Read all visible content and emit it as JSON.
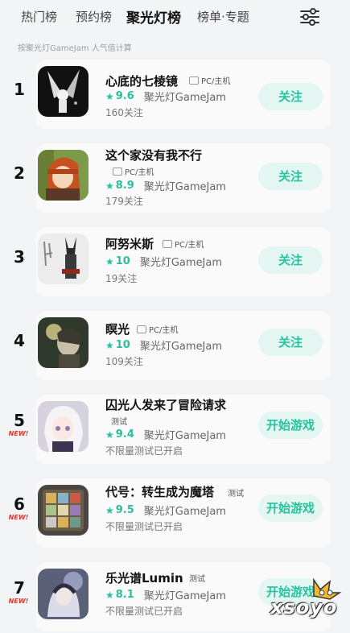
{
  "tabs": [
    {
      "label": "热门榜",
      "active": false
    },
    {
      "label": "预约榜",
      "active": false
    },
    {
      "label": "聚光灯榜",
      "active": true
    },
    {
      "label": "榜单·专题",
      "active": false
    }
  ],
  "filter_icon": "sliders-icon",
  "subtitle": "按聚光灯GameJam 人气值计算",
  "accent_color": "#2bbf9e",
  "new_color": "#e2332b",
  "games": [
    {
      "rank": "1",
      "is_new": false,
      "name": "心底的七棱镜",
      "tag": "PC/主机",
      "tag_type": "platform",
      "score": "9.6",
      "source": "聚光灯GameJam",
      "sub": "160关注",
      "button": "关注"
    },
    {
      "rank": "2",
      "is_new": false,
      "name": "这个家没有我不行",
      "tag": "PC/主机",
      "tag_type": "platform",
      "score": "8.9",
      "source": "聚光灯GameJam",
      "sub": "179关注",
      "button": "关注"
    },
    {
      "rank": "3",
      "is_new": false,
      "name": "阿努米斯",
      "tag": "PC/主机",
      "tag_type": "platform",
      "score": "10",
      "source": "聚光灯GameJam",
      "sub": "19关注",
      "button": "关注"
    },
    {
      "rank": "4",
      "is_new": false,
      "name": "瞑光",
      "tag": "PC/主机",
      "tag_type": "platform",
      "score": "10",
      "source": "聚光灯GameJam",
      "sub": "109关注",
      "button": "关注"
    },
    {
      "rank": "5",
      "is_new": true,
      "new_label": "NEW!",
      "name": "囚光人发来了冒险请求",
      "tag": "测试",
      "tag_type": "test",
      "score": "9.4",
      "source": "聚光灯GameJam",
      "sub": "不限量测试已开启",
      "button": "开始游戏"
    },
    {
      "rank": "6",
      "is_new": true,
      "new_label": "NEW!",
      "name": "代号：转生成为魔塔",
      "tag": "测试",
      "tag_type": "test",
      "score": "9.5",
      "source": "聚光灯GameJam",
      "sub": "不限量测试已开启",
      "button": "开始游戏"
    },
    {
      "rank": "7",
      "is_new": true,
      "new_label": "NEW!",
      "name": "乐光谱Lumin",
      "tag": "测试",
      "tag_type": "test",
      "score": "8.1",
      "source": "聚光灯GameJam",
      "sub": "不限量测试已开启",
      "button": "开始游戏"
    }
  ],
  "watermark": "xsoyo"
}
